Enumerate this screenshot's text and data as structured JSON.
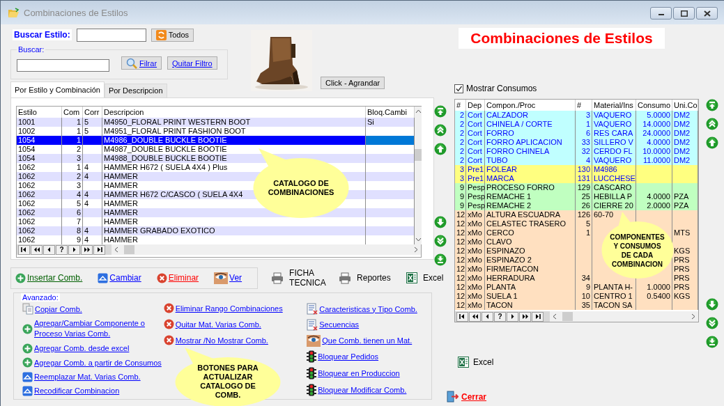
{
  "window": {
    "title": "Combinaciones de Estilos"
  },
  "heading": "Combinaciones de Estilos",
  "search_style": {
    "label": "Buscar Estilo:",
    "all_button": "Todos"
  },
  "filter": {
    "legend": "Buscar:",
    "filter_button": "Filrar",
    "clear_button": "Quitar Filtro"
  },
  "image_button": "Click - Agrandar",
  "tabs": [
    {
      "label": "Por Estilo y Combinación",
      "selected": true
    },
    {
      "label": "Por Descripcion",
      "selected": false
    }
  ],
  "catalog_grid": {
    "columns": [
      "Estilo",
      "Com",
      "Corr",
      "Descripcion",
      "Bloq.Cambi"
    ],
    "rows": [
      {
        "cells": [
          "1001",
          "1",
          "5",
          "M4950_FLORAL PRINT WESTERN BOOT",
          "Si"
        ],
        "selected": false
      },
      {
        "cells": [
          "1002",
          "1",
          "5",
          "M4951_FLORAL PRINT FASHION BOOT",
          null
        ],
        "selected": false
      },
      {
        "cells": [
          "1054",
          "1",
          null,
          "M4986_DOUBLE BUCKLE BOOTIE",
          null
        ],
        "selected": true
      },
      {
        "cells": [
          "1054",
          "2",
          null,
          "M4987_DOUBLE BUCKLE BOOTIE",
          null
        ],
        "selected": false
      },
      {
        "cells": [
          "1054",
          "3",
          null,
          "M4988_DOUBLE BUCKLE BOOTIE",
          null
        ],
        "selected": false
      },
      {
        "cells": [
          "1062",
          "1",
          "4",
          "HAMMER H672  ( SUELA 4X4   ) Plus",
          null
        ],
        "selected": false
      },
      {
        "cells": [
          "1062",
          "2",
          "4",
          "HAMMER",
          null
        ],
        "selected": false
      },
      {
        "cells": [
          "1062",
          "3",
          null,
          "HAMMER",
          null
        ],
        "selected": false
      },
      {
        "cells": [
          "1062",
          "4",
          "4",
          "HAMMER H672  C/CASCO ( SUELA 4X4",
          null
        ],
        "selected": false
      },
      {
        "cells": [
          "1062",
          "5",
          "4",
          "HAMMER",
          null
        ],
        "selected": false
      },
      {
        "cells": [
          "1062",
          "6",
          null,
          "HAMMER",
          null
        ],
        "selected": false
      },
      {
        "cells": [
          "1062",
          "7",
          null,
          "HAMMER",
          null
        ],
        "selected": false
      },
      {
        "cells": [
          "1062",
          "8",
          "4",
          "HAMMER GRABADO EXOTICO",
          null
        ],
        "selected": false
      },
      {
        "cells": [
          "1062",
          "9",
          "4",
          "HAMMER",
          null
        ],
        "selected": false
      }
    ],
    "navigator": [
      {
        "kind": "first"
      },
      {
        "kind": "prev_page"
      },
      {
        "kind": "prev"
      },
      {
        "kind": "help",
        "label": "?"
      },
      {
        "kind": "next"
      },
      {
        "kind": "next_page"
      },
      {
        "kind": "last"
      }
    ],
    "move_buttons": [
      {
        "kind": "top"
      },
      {
        "kind": "up_page"
      },
      {
        "kind": "up"
      },
      {
        "kind": "down"
      },
      {
        "kind": "down_page"
      },
      {
        "kind": "bottom"
      }
    ]
  },
  "catalog_callout": "CATALOGO DE\nCOMBINACIONES",
  "actions": [
    {
      "label": "Insertar Comb.",
      "kind": "plus",
      "color": "#005f00"
    },
    {
      "label": "Cambiar",
      "kind": "edit",
      "color": "#0000ff"
    },
    {
      "label": "Eliminar",
      "kind": "delete",
      "color": "#ff0000"
    },
    {
      "label": "Ver",
      "kind": "eye",
      "color": "#0000ff"
    }
  ],
  "tools": [
    {
      "label": "FICHA TECNICA",
      "kind": "printer"
    },
    {
      "label": "Reportes",
      "kind": "printer"
    },
    {
      "label": "Excel",
      "kind": "excel"
    }
  ],
  "advanced": {
    "legend": "Avanzado:",
    "columns": [
      [
        {
          "label": "Copiar Comb.",
          "kind": "copy"
        },
        {
          "label": "Agregar/Cambiar Componente o Proceso Varias Comb.",
          "kind": "plus"
        },
        {
          "label": "Agregar Comb. desde excel",
          "kind": "plus"
        },
        {
          "label": "Agregar Comb. a partir de Consumos",
          "kind": "plus"
        },
        {
          "label": "Reemplazar Mat. Varias Comb.",
          "kind": "edit"
        },
        {
          "label": "Recodificar Combinacion",
          "kind": "edit"
        }
      ],
      [
        {
          "label": "Eliminar Rango Combinaciones",
          "kind": "delete"
        },
        {
          "label": "Quitar Mat. Varias Comb.",
          "kind": "delete"
        },
        {
          "label": "Mostrar /No Mostrar Comb.",
          "kind": "delete"
        }
      ],
      [
        {
          "label": "Caracteristicas y Tipo Comb.",
          "kind": "document"
        },
        {
          "label": "Secuencias",
          "kind": "document"
        },
        {
          "label": "Que Comb. tienen un Mat.",
          "kind": "eye"
        },
        {
          "label": "Bloquear Pedidos",
          "kind": "traffic"
        },
        {
          "label": "Bloquear en Produccion",
          "kind": "traffic"
        },
        {
          "label": "Bloquear Modificar Comb.",
          "kind": "traffic"
        }
      ]
    ]
  },
  "buttons_callout": "BOTONES PARA\nACTUALIZAR\nCATALOGO DE\nCOMB.",
  "show_consumption": {
    "label": "Mostrar Consumos",
    "checked": true
  },
  "components_grid": {
    "columns": [
      "#",
      "Dep",
      "Compon./Proc",
      "#",
      "Material/Ins",
      "Consumo",
      "Uni.Co"
    ],
    "rows": [
      {
        "color": "#c0ffff",
        "emphasized": true,
        "cells": [
          "2",
          "Cort",
          "CALZADOR",
          "3",
          "VAQUERO",
          "5.0000",
          "DM2"
        ]
      },
      {
        "color": "#c0ffff",
        "emphasized": true,
        "cells": [
          "2",
          "Cort",
          "CHINELA / CORTE",
          "1",
          "VAQUERO",
          "14.0000",
          "DM2"
        ]
      },
      {
        "color": "#c0ffff",
        "emphasized": true,
        "cells": [
          "2",
          "Cort",
          "FORRO",
          "6",
          "RES CARA",
          "24.0000",
          "DM2"
        ]
      },
      {
        "color": "#c0ffff",
        "emphasized": true,
        "cells": [
          "2",
          "Cort",
          "FORRO APLICACION",
          "33",
          "SILLERO V",
          "4.0000",
          "DM2"
        ]
      },
      {
        "color": "#c0ffff",
        "emphasized": true,
        "cells": [
          "2",
          "Cort",
          "FORRO CHINELA",
          "32",
          "CERDO FL",
          "10.0000",
          "DM2"
        ]
      },
      {
        "color": "#c0ffff",
        "emphasized": true,
        "cells": [
          "2",
          "Cort",
          "TUBO",
          "4",
          "VAQUERO",
          "11.0000",
          "DM2"
        ]
      },
      {
        "color": "#ffff80",
        "emphasized": true,
        "cells": [
          "3",
          "Pre1",
          "FOLEAR",
          "130",
          "M4986",
          null,
          null
        ]
      },
      {
        "color": "#ffff80",
        "emphasized": true,
        "cells": [
          "3",
          "Pre1",
          "MARCA",
          "131",
          "LUCCHESE",
          null,
          null
        ]
      },
      {
        "color": "#c0ffc0",
        "emphasized": false,
        "cells": [
          "9",
          "Pesp",
          "PROCESO FORRO",
          "129",
          "CASCARO",
          null,
          null
        ]
      },
      {
        "color": "#c0ffc0",
        "emphasized": false,
        "cells": [
          "9",
          "Pesp",
          "REMACHE 1",
          "25",
          "HEBILLA P",
          "4.0000",
          "PZA"
        ]
      },
      {
        "color": "#c0ffc0",
        "emphasized": false,
        "cells": [
          "9",
          "Pesp",
          "REMACHE 2",
          "26",
          "CIERRE 20",
          "2.0000",
          "PZA"
        ]
      },
      {
        "color": "#ffe0c0",
        "emphasized": false,
        "cells": [
          "12",
          "xMo",
          "ALTURA ESCUADRA",
          "126",
          "60-70",
          null,
          null
        ]
      },
      {
        "color": "#ffe0c0",
        "emphasized": false,
        "cells": [
          "12",
          "xMo",
          "CELASTEC TRASERO",
          "5",
          null,
          null,
          null
        ]
      },
      {
        "color": "#ffe0c0",
        "emphasized": false,
        "cells": [
          "12",
          "xMo",
          "CERCO",
          "1",
          null,
          null,
          "MTS"
        ]
      },
      {
        "color": "#ffe0c0",
        "emphasized": false,
        "cells": [
          "12",
          "xMo",
          "CLAVO",
          null,
          null,
          null,
          null
        ]
      },
      {
        "color": "#ffe0c0",
        "emphasized": false,
        "cells": [
          "12",
          "xMo",
          "ESPINAZO",
          null,
          null,
          null,
          "KGS"
        ]
      },
      {
        "color": "#ffe0c0",
        "emphasized": false,
        "cells": [
          "12",
          "xMo",
          "ESPINAZO 2",
          null,
          null,
          null,
          "PRS"
        ]
      },
      {
        "color": "#ffe0c0",
        "emphasized": false,
        "cells": [
          "12",
          "xMo",
          "FIRME/TACON",
          null,
          null,
          null,
          "PRS"
        ]
      },
      {
        "color": "#ffe0c0",
        "emphasized": false,
        "cells": [
          "12",
          "xMo",
          "HERRADURA",
          "34",
          null,
          null,
          "PRS"
        ]
      },
      {
        "color": "#ffe0c0",
        "emphasized": false,
        "cells": [
          "12",
          "xMo",
          "PLANTA",
          "9",
          "PLANTA H-",
          "1.0000",
          "PRS"
        ]
      },
      {
        "color": "#ffe0c0",
        "emphasized": false,
        "cells": [
          "12",
          "xMo",
          "SUELA 1",
          "10",
          "CENTRO 1",
          "0.5400",
          "KGS"
        ]
      },
      {
        "color": "#ffe0c0",
        "emphasized": false,
        "cells": [
          "12",
          "xMo",
          "TACON",
          "35",
          "TACON SA",
          null,
          null
        ]
      }
    ],
    "navigator": [
      {
        "kind": "first"
      },
      {
        "kind": "prev_page"
      },
      {
        "kind": "prev"
      },
      {
        "kind": "help",
        "label": "?"
      },
      {
        "kind": "next"
      },
      {
        "kind": "next_page"
      },
      {
        "kind": "last"
      }
    ],
    "move_buttons": [
      {
        "kind": "top"
      },
      {
        "kind": "up_page"
      },
      {
        "kind": "up"
      },
      {
        "kind": "down"
      },
      {
        "kind": "down_page"
      },
      {
        "kind": "bottom"
      }
    ]
  },
  "components_callout": "COMPONENTES\nY CONSUMOS\nDE CADA\nCOMBINACION",
  "excel_button": "Excel",
  "close_button": "Cerrar"
}
